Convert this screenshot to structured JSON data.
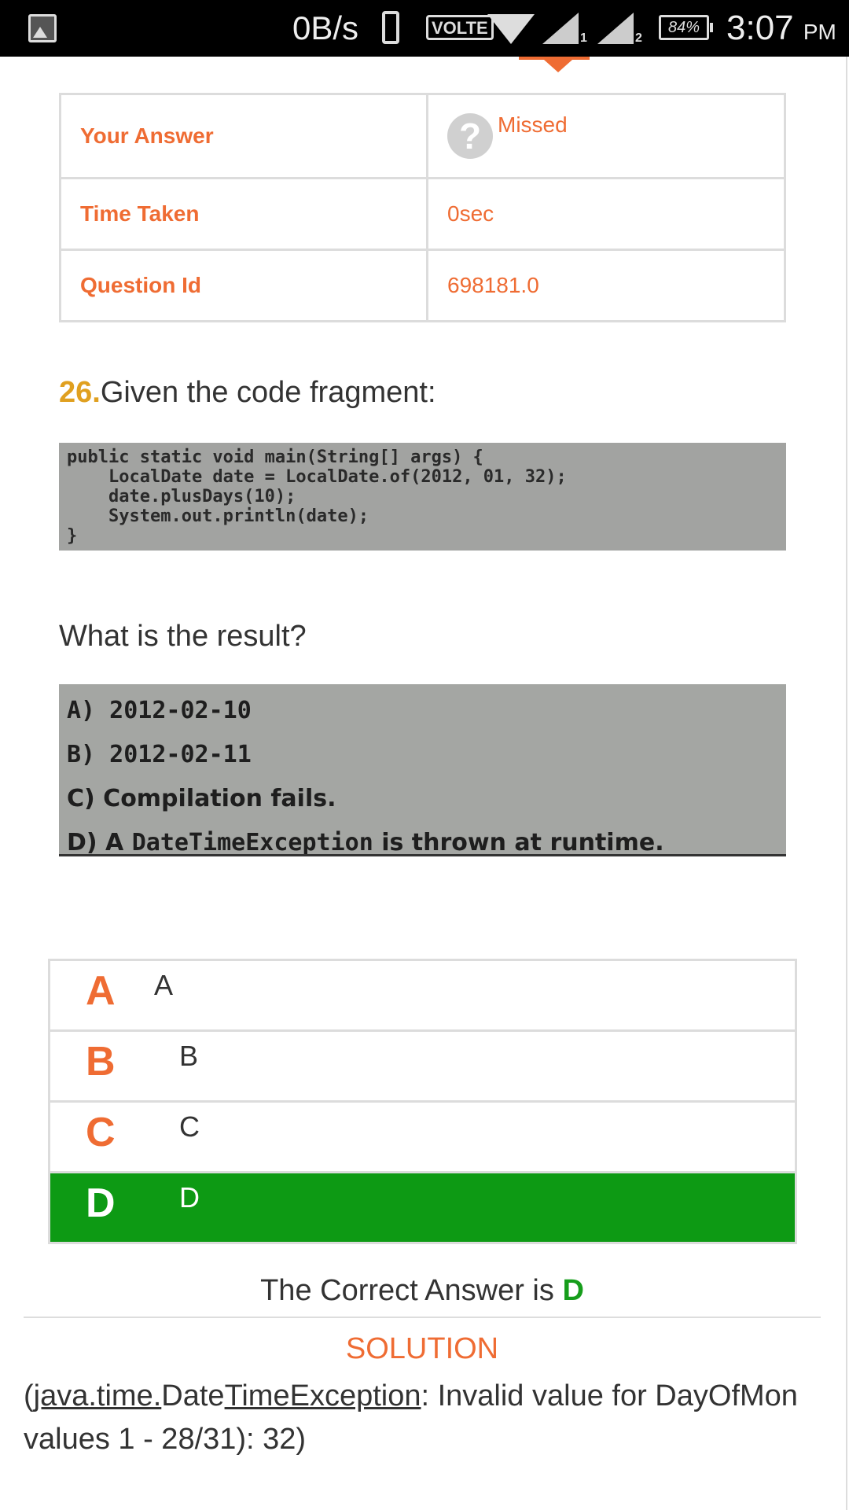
{
  "status_bar": {
    "speed": "0B/s",
    "volte": "VOLTE",
    "sim1": "1",
    "sim2": "2",
    "battery": "84%",
    "time": "3:07",
    "ampm": "PM"
  },
  "info_table": {
    "your_answer_label": "Your Answer",
    "your_answer_value": "Missed",
    "time_taken_label": "Time Taken",
    "time_taken_value": "0sec",
    "question_id_label": "Question Id",
    "question_id_value": "698181.0"
  },
  "question": {
    "number": "26.",
    "title": "Given the code fragment:",
    "code_lines": [
      "public static void main(String[] args) {",
      "    LocalDate date = LocalDate.of(2012, 01, 32);",
      "    date.plusDays(10);",
      "    System.out.println(date);",
      "}"
    ],
    "prompt": "What is the result?",
    "options_image": [
      "A) 2012-02-10",
      "B) 2012-02-11",
      "C) Compilation fails.",
      "D) A ",
      "DateTimeException",
      " is thrown at runtime."
    ]
  },
  "choices": [
    {
      "letter": "A",
      "text": "A"
    },
    {
      "letter": "B",
      "text": "B"
    },
    {
      "letter": "C",
      "text": "C"
    },
    {
      "letter": "D",
      "text": "D"
    }
  ],
  "result": {
    "prefix": "The Correct Answer is ",
    "answer": "D"
  },
  "solution": {
    "title": "SOLUTION",
    "open_paren": "(",
    "pkg": "java.time.",
    "cls_a": "Date",
    "cls_b": "TimeException",
    "line1_rest": ": Invalid value for DayOfMon",
    "line2": "values 1 - 28/31): 32)"
  },
  "colors": {
    "accent": "#ef6c33",
    "correct": "#0d9a14",
    "question_number": "#e0a020"
  }
}
